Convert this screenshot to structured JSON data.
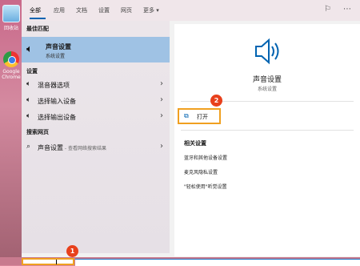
{
  "desktop": {
    "icons": [
      {
        "label": "回收站"
      },
      {
        "label": "Google Chrome"
      }
    ]
  },
  "tabs": [
    "全部",
    "应用",
    "文档",
    "设置",
    "网页",
    "更多 ▾"
  ],
  "left": {
    "best_match_title": "最佳匹配",
    "best_match": {
      "title": "声音设置",
      "subtitle": "系统设置"
    },
    "settings_title": "设置",
    "settings_items": [
      {
        "label": "混音器选项"
      },
      {
        "label": "选择输入设备"
      },
      {
        "label": "选择输出设备"
      }
    ],
    "web_title": "搜索网页",
    "web_item": {
      "label": "声音设置",
      "suffix": " - 查看网络搜索结果"
    }
  },
  "right": {
    "title": "声音设置",
    "subtitle": "系统设置",
    "open_label": "打开",
    "related_title": "相关设置",
    "related_links": [
      "蓝牙和其他设备设置",
      "麦克风隐私设置",
      "\"轻松使用\"听觉设置"
    ]
  },
  "callouts": [
    "1",
    "2"
  ],
  "colors": {
    "accent": "#0063b1",
    "highlight": "#f0a020",
    "badge": "#e8401c"
  }
}
